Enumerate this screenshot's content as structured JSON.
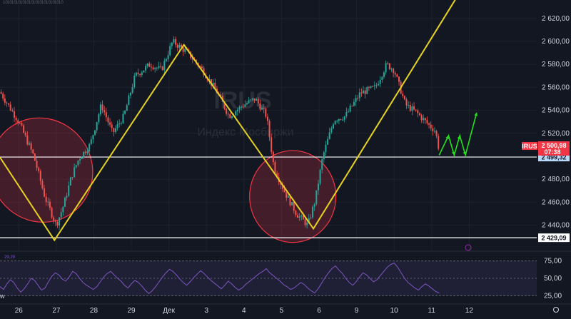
{
  "chart_data": {
    "type": "candlestick",
    "symbol": "IRUS",
    "watermark": {
      "title": "IRUS",
      "subtitle": "Индекс Мосбиржи"
    },
    "price_axis": {
      "ticks": [
        "2 620,00",
        "2 600,00",
        "2 580,00",
        "2 560,00",
        "2 540,00",
        "2 520,00",
        "2 480,00",
        "2 460,00",
        "2 440,00"
      ],
      "tick_values": [
        2620,
        2600,
        2580,
        2560,
        2540,
        2520,
        2480,
        2460,
        2440
      ],
      "ylim": [
        2418,
        2636
      ]
    },
    "x_axis": {
      "labels": [
        "26",
        "27",
        "28",
        "29",
        "Дек",
        "3",
        "4",
        "5",
        "6",
        "9",
        "10",
        "11",
        "12"
      ],
      "positions": [
        0.5,
        1.5,
        2.5,
        3.5,
        4.5,
        5.5,
        6.5,
        7.5,
        8.5,
        9.5,
        10.5,
        11.5,
        12.5
      ],
      "xlim": [
        0,
        14.3
      ]
    },
    "current_price": {
      "label": "IRUS",
      "value": "2 500,98",
      "timer": "07:38",
      "color": "#f23645"
    },
    "levels": [
      {
        "value": 2499.32,
        "label": "2 499,32",
        "color": "#ffffff"
      },
      {
        "value": 2429.09,
        "label": "2 429,09",
        "color": "#ffffff"
      }
    ],
    "price_path": [
      [
        0,
        2556
      ],
      [
        0.5,
        2530
      ],
      [
        0.9,
        2500
      ],
      [
        1.2,
        2464
      ],
      [
        1.5,
        2440
      ],
      [
        1.7,
        2458
      ],
      [
        1.9,
        2482
      ],
      [
        2.1,
        2498
      ],
      [
        2.4,
        2510
      ],
      [
        2.7,
        2545
      ],
      [
        3.0,
        2520
      ],
      [
        3.3,
        2535
      ],
      [
        3.6,
        2570
      ],
      [
        4.0,
        2580
      ],
      [
        4.3,
        2575
      ],
      [
        4.6,
        2600
      ],
      [
        5.0,
        2590
      ],
      [
        5.4,
        2575
      ],
      [
        5.8,
        2555
      ],
      [
        6.1,
        2535
      ],
      [
        6.5,
        2545
      ],
      [
        6.8,
        2550
      ],
      [
        7.1,
        2535
      ],
      [
        7.3,
        2490
      ],
      [
        7.6,
        2468
      ],
      [
        7.9,
        2450
      ],
      [
        8.2,
        2440
      ],
      [
        8.4,
        2462
      ],
      [
        8.6,
        2500
      ],
      [
        8.9,
        2532
      ],
      [
        9.2,
        2535
      ],
      [
        9.6,
        2555
      ],
      [
        10.0,
        2560
      ],
      [
        10.3,
        2580
      ],
      [
        10.5,
        2575
      ],
      [
        10.8,
        2545
      ],
      [
        11.1,
        2538
      ],
      [
        11.4,
        2528
      ],
      [
        11.6,
        2522
      ],
      [
        11.7,
        2505
      ]
    ],
    "drawings": {
      "zigzag": [
        [
          0,
          2499
        ],
        [
          1.45,
          2427
        ],
        [
          4.9,
          2597
        ],
        [
          8.35,
          2437
        ],
        [
          12.2,
          2640
        ]
      ],
      "forecast": [
        [
          11.7,
          2501
        ],
        [
          11.95,
          2518
        ],
        [
          12.1,
          2501
        ],
        [
          12.25,
          2518
        ],
        [
          12.4,
          2501
        ],
        [
          12.7,
          2538
        ]
      ],
      "ellipses": [
        {
          "cx": 1.1,
          "cy": 2488,
          "rx": 1.35,
          "ry": 46,
          "angle": 35
        },
        {
          "cx": 7.8,
          "cy": 2465,
          "rx": 1.15,
          "ry": 40,
          "angle": 0
        }
      ],
      "zigzag_color": "#e6d21e",
      "forecast_color": "#22e31a",
      "ellipse_color": "#f23645"
    },
    "rsi": {
      "value_label": "29,29",
      "ticks": [
        "75,00",
        "50,00",
        "25,00"
      ],
      "tick_values": [
        75,
        50,
        25
      ],
      "ylim": [
        15,
        85
      ],
      "values": [
        38,
        34,
        42,
        48,
        44,
        36,
        30,
        35,
        42,
        50,
        47,
        40,
        33,
        36,
        45,
        53,
        58,
        55,
        49,
        46,
        52,
        60,
        57,
        50,
        44,
        40,
        37,
        34,
        38,
        45,
        52,
        57,
        60,
        55,
        50,
        46,
        40,
        36,
        42,
        47,
        44,
        39,
        33,
        28,
        32,
        38,
        45,
        52,
        58,
        63,
        60,
        55,
        49,
        44,
        40,
        45,
        51,
        56,
        61,
        57,
        52,
        47,
        43,
        39,
        35,
        40,
        46,
        42,
        37,
        33,
        36,
        41,
        45,
        49,
        53,
        57,
        60,
        64,
        58,
        54,
        50,
        46,
        41,
        38,
        34,
        36,
        40,
        44,
        41,
        36,
        32,
        29,
        35,
        43,
        51,
        58,
        64,
        68,
        62,
        57,
        50,
        44,
        40,
        45,
        52,
        58,
        55,
        50,
        45,
        48,
        54,
        60,
        66,
        70,
        72,
        66,
        58,
        50,
        44,
        40,
        36,
        33,
        38,
        42,
        39,
        35,
        31,
        29
      ],
      "line_color": "#7e57c2"
    },
    "tiny_labels": [
      "10",
      "10",
      "10",
      "10",
      "10",
      "10",
      "10",
      "10",
      "10",
      "10",
      "10",
      "10",
      "10",
      "10"
    ]
  }
}
